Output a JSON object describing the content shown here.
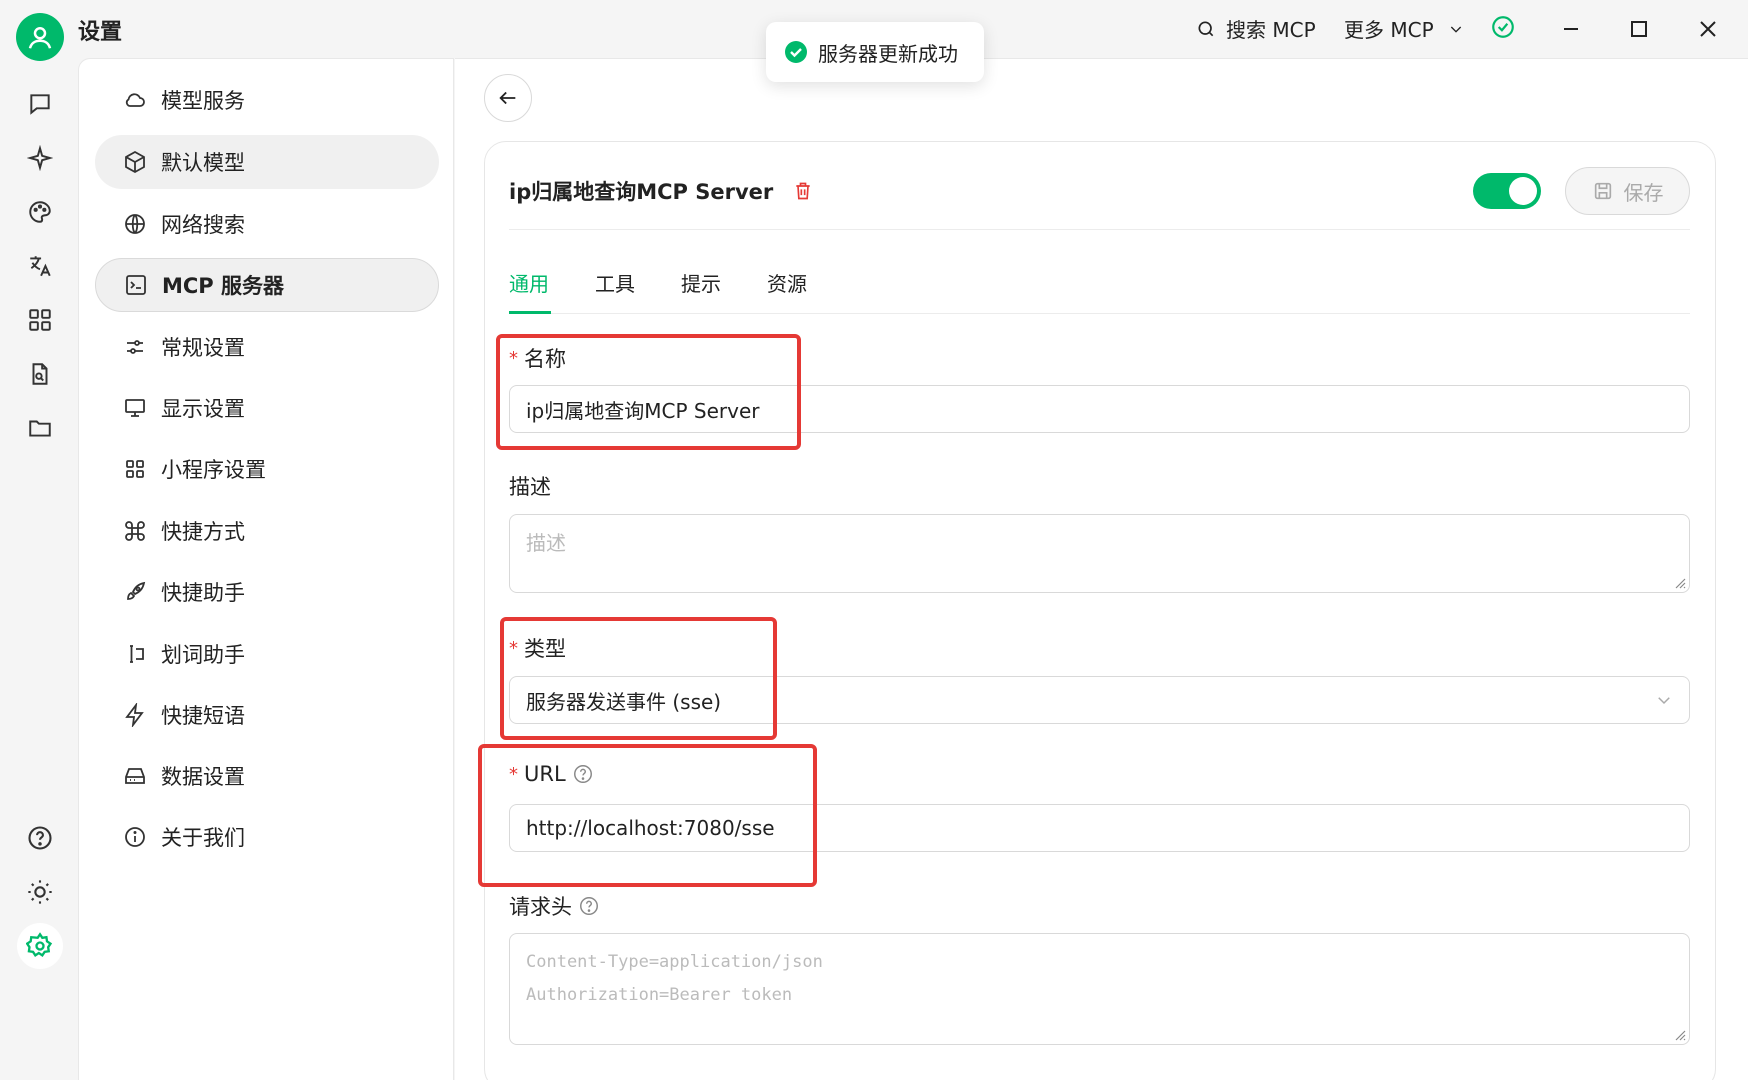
{
  "app": {
    "title": "设置"
  },
  "topbar": {
    "search_label": "搜索 MCP",
    "more_label": "更多 MCP"
  },
  "toast": {
    "message": "服务器更新成功"
  },
  "menu": {
    "items": [
      {
        "label": "模型服务",
        "icon": "cloud-icon"
      },
      {
        "label": "默认模型",
        "icon": "cube-icon"
      },
      {
        "label": "网络搜索",
        "icon": "globe-icon"
      },
      {
        "label": "MCP 服务器",
        "icon": "terminal-icon"
      },
      {
        "label": "常规设置",
        "icon": "sliders-icon"
      },
      {
        "label": "显示设置",
        "icon": "monitor-icon"
      },
      {
        "label": "小程序设置",
        "icon": "grid-icon"
      },
      {
        "label": "快捷方式",
        "icon": "command-icon"
      },
      {
        "label": "快捷助手",
        "icon": "rocket-icon"
      },
      {
        "label": "划词助手",
        "icon": "text-cursor-icon"
      },
      {
        "label": "快捷短语",
        "icon": "zap-icon"
      },
      {
        "label": "数据设置",
        "icon": "hard-drive-icon"
      },
      {
        "label": "关于我们",
        "icon": "info-icon"
      }
    ]
  },
  "server": {
    "title": "ip归属地查询MCP Server",
    "enabled": true,
    "save_label": "保存"
  },
  "tabs": [
    "通用",
    "工具",
    "提示",
    "资源"
  ],
  "form": {
    "name_label": "名称",
    "name_value": "ip归属地查询MCP Server",
    "desc_label": "描述",
    "desc_placeholder": "描述",
    "type_label": "类型",
    "type_value": "服务器发送事件 (sse)",
    "url_label": "URL",
    "url_value": "http://localhost:7080/sse",
    "headers_label": "请求头",
    "headers_placeholder_line1": "Content-Type=application/json",
    "headers_placeholder_line2": "Authorization=Bearer token"
  },
  "colors": {
    "accent": "#00b96b",
    "highlight": "#e53935"
  }
}
